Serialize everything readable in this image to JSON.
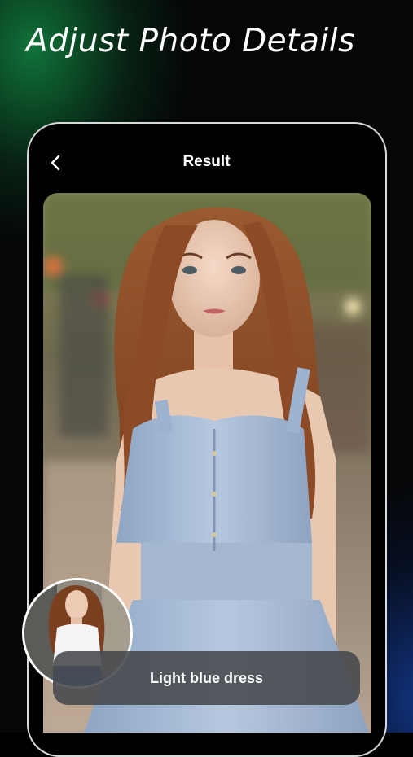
{
  "headline": "Adjust Photo Details",
  "screen": {
    "title": "Result",
    "back_icon": "chevron-left-icon"
  },
  "result_photo": {
    "subject": "Woman with long auburn hair wearing a light blue denim sundress on a city street"
  },
  "before_thumbnail": {
    "subject": "Same woman wearing a white top and jeans"
  },
  "caption": "Light blue dress",
  "colors": {
    "accent_green": "#10783c",
    "accent_blue": "#143c96",
    "caption_background": "#46484c"
  }
}
